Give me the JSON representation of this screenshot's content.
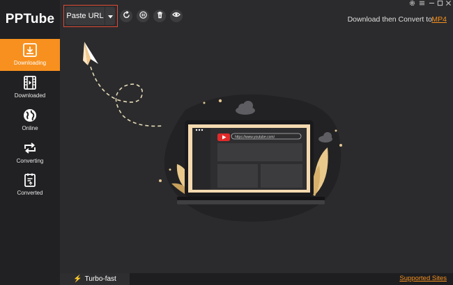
{
  "app": {
    "name": "PPTube"
  },
  "sidebar": {
    "items": [
      {
        "label": "Downloading",
        "icon": "download-icon",
        "active": true
      },
      {
        "label": "Downloaded",
        "icon": "film-icon",
        "active": false
      },
      {
        "label": "Online",
        "icon": "globe-icon",
        "active": false
      },
      {
        "label": "Converting",
        "icon": "convert-arrows-icon",
        "active": false
      },
      {
        "label": "Converted",
        "icon": "converted-file-icon",
        "active": false
      }
    ]
  },
  "toolbar": {
    "paste_label": "Paste URL",
    "buttons": [
      "refresh-icon",
      "pause-icon",
      "trash-icon",
      "eye-icon"
    ],
    "convert_text": "Download then Convert to",
    "convert_format": "MP4"
  },
  "illustration": {
    "url": "https://www.youtube.com/"
  },
  "bottom": {
    "turbo_label": "Turbo-fast",
    "supported_label": "Supported Sites"
  },
  "colors": {
    "accent": "#f7901e",
    "highlight_border": "#e04a34",
    "background": "#2b2b2d",
    "sidebar": "#212123"
  }
}
